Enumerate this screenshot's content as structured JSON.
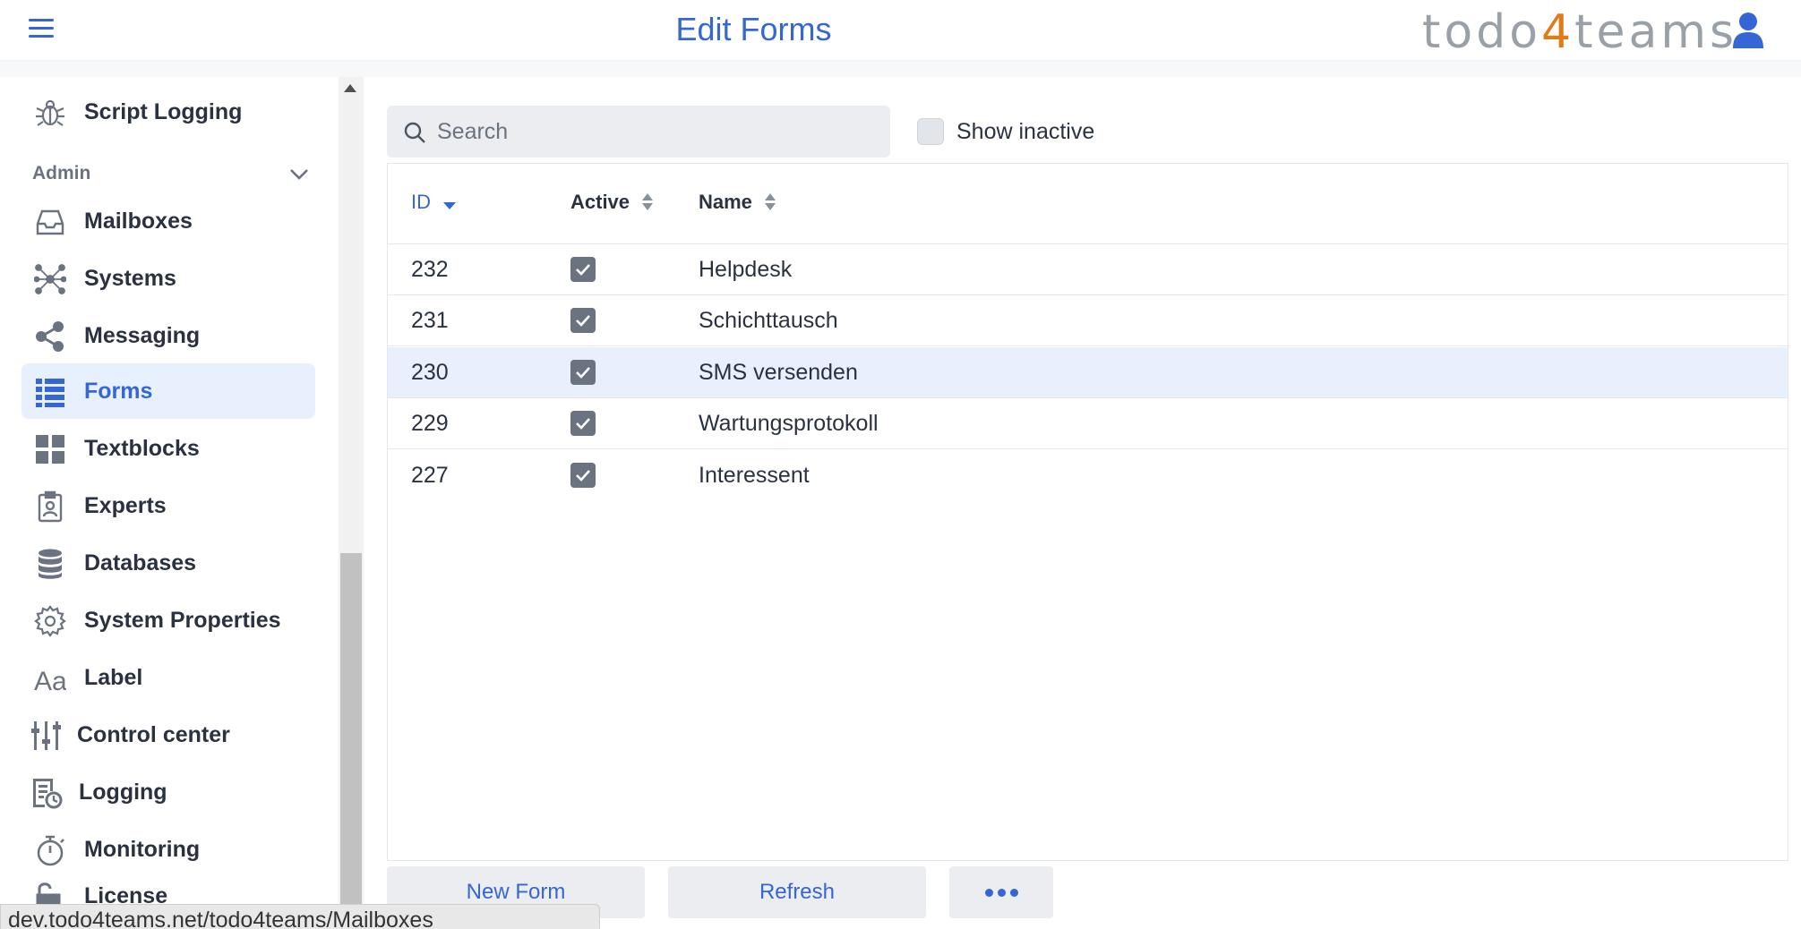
{
  "header": {
    "title": "Edit Forms",
    "logo_prefix": "todo",
    "logo_digit": "4",
    "logo_suffix": "teams"
  },
  "sidebar": {
    "items_top": [
      {
        "label": "Script Logging",
        "icon": "bug-icon"
      }
    ],
    "section": {
      "label": "Admin",
      "expanded": true
    },
    "items": [
      {
        "label": "Mailboxes",
        "icon": "inbox-icon",
        "active": false
      },
      {
        "label": "Systems",
        "icon": "network-icon",
        "active": false
      },
      {
        "label": "Messaging",
        "icon": "share-icon",
        "active": false
      },
      {
        "label": "Forms",
        "icon": "list-icon",
        "active": true
      },
      {
        "label": "Textblocks",
        "icon": "grid-icon",
        "active": false
      },
      {
        "label": "Experts",
        "icon": "badge-icon",
        "active": false
      },
      {
        "label": "Databases",
        "icon": "database-icon",
        "active": false
      },
      {
        "label": "System Properties",
        "icon": "gear-icon",
        "active": false
      },
      {
        "label": "Label",
        "icon": "text-aa-icon",
        "active": false
      },
      {
        "label": "Control center",
        "icon": "sliders-icon",
        "active": false
      },
      {
        "label": "Logging",
        "icon": "log-icon",
        "active": false
      },
      {
        "label": "Monitoring",
        "icon": "stopwatch-icon",
        "active": false
      },
      {
        "label": "License",
        "icon": "unlock-icon",
        "active": false
      }
    ]
  },
  "toolbar": {
    "search_placeholder": "Search",
    "show_inactive_label": "Show inactive",
    "show_inactive_checked": false
  },
  "table": {
    "columns": [
      "ID",
      "Active",
      "Name"
    ],
    "sort": {
      "column": "ID",
      "direction": "desc"
    },
    "rows": [
      {
        "id": "232",
        "active": true,
        "name": "Helpdesk",
        "selected": false
      },
      {
        "id": "231",
        "active": true,
        "name": "Schichttausch",
        "selected": false
      },
      {
        "id": "230",
        "active": true,
        "name": "SMS versenden",
        "selected": true
      },
      {
        "id": "229",
        "active": true,
        "name": "Wartungsprotokoll",
        "selected": false
      },
      {
        "id": "227",
        "active": true,
        "name": "Interessent",
        "selected": false
      }
    ]
  },
  "actions": {
    "new_label": "New Form",
    "refresh_label": "Refresh",
    "more_icon": "more-dots-icon"
  },
  "status_bar": {
    "url": "dev.todo4teams.net/todo4teams/Mailboxes"
  },
  "colors": {
    "accent": "#3466d6",
    "logo_digit": "#e37b15",
    "selected_row": "#e8effd"
  }
}
